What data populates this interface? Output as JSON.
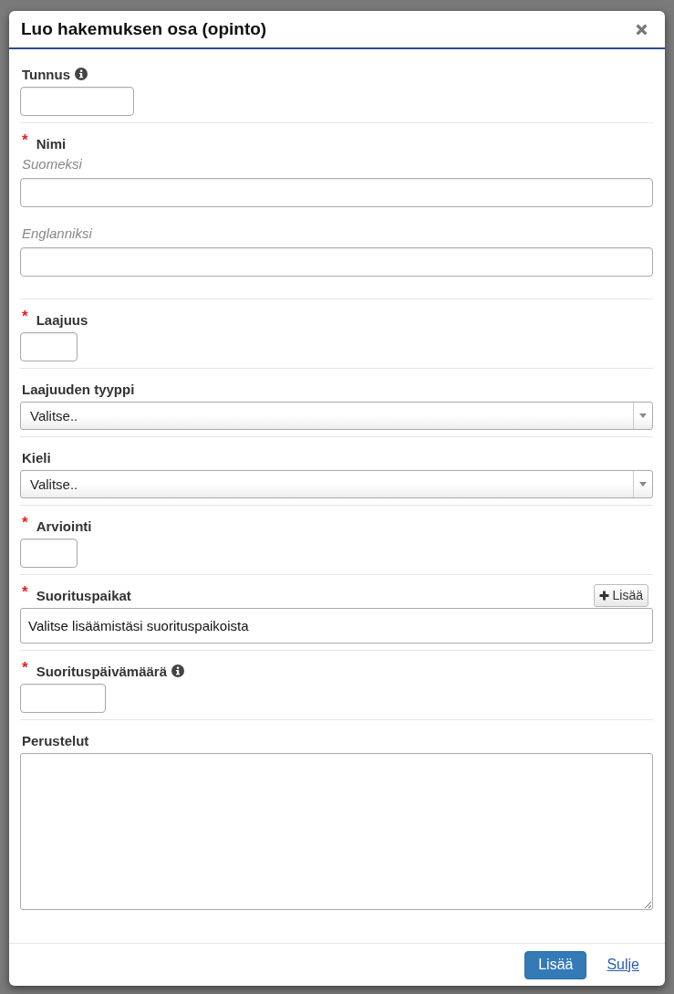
{
  "dialog": {
    "title": "Luo hakemuksen osa (opinto)"
  },
  "fields": [
    {
      "kind": "input",
      "label": "Tunnus",
      "info": true
    },
    {
      "kind": "languages",
      "label": "Nimi",
      "required_mark": "*",
      "inputs": [
        {
          "label": "Suomeksi"
        },
        {
          "label": "Englanniksi"
        }
      ]
    },
    {
      "kind": "input",
      "label": "Laajuus",
      "required_mark": "*"
    },
    {
      "kind": "select",
      "label": "Laajuuden tyyppi",
      "value": "Valitse.."
    },
    {
      "kind": "select",
      "label": "Kieli",
      "value": "Valitse.."
    },
    {
      "kind": "input",
      "label": "Arviointi",
      "required_mark": "*"
    },
    {
      "kind": "picker",
      "label": "Suorituspaikat",
      "required_mark": "*",
      "add_button": "Lisää",
      "value": "Valitse lisäämistäsi suorituspaikoista"
    },
    {
      "kind": "input",
      "label": "Suorituspäivämäärä",
      "required_mark": "*",
      "info": true
    },
    {
      "kind": "textarea",
      "label": "Perustelut"
    }
  ],
  "buttons": [
    {
      "label": "Lisää",
      "kind": "primary"
    },
    {
      "label": "Sulje",
      "kind": "link"
    }
  ]
}
